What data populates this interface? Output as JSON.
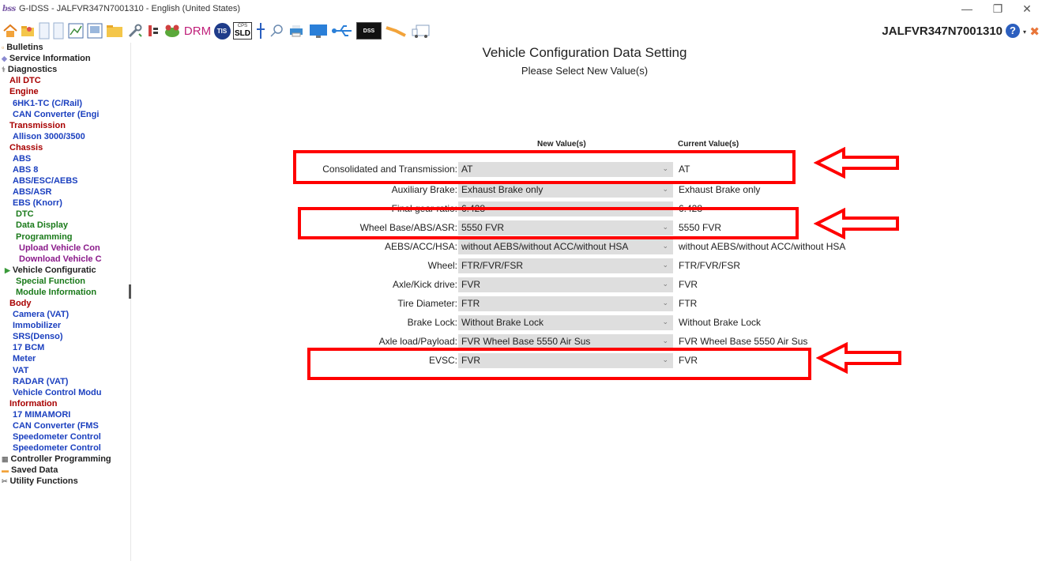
{
  "window": {
    "app_logo": "bss",
    "title": "G-IDSS - JALFVR347N7001310 - English (United States)",
    "controls": [
      "—",
      "❐",
      "✕"
    ]
  },
  "toolbar": {
    "icons": [
      "home-icon",
      "open-folder-icon",
      "blank-page-icon",
      "blank-page-2-icon",
      "graph-icon",
      "image-icon",
      "folder-icon",
      "wrench-icon",
      "connector-icon",
      "frog-icon",
      "drm-icon",
      "tis-icon",
      "cps-sld-icon",
      "pin-icon",
      "search-icon",
      "print-icon",
      "monitor-icon",
      "usb-icon",
      "dss-icon",
      "plane-icon",
      "truck-icon"
    ],
    "drm_label": "DRM",
    "tis_label": "TIS",
    "cps_label": "CPS",
    "sld_label": "SLD",
    "dss_label": "DSS",
    "vin": "JALFVR347N7001310",
    "help_label": "?"
  },
  "sidebar": {
    "items": [
      {
        "label": "Bulletins",
        "color": "#222222",
        "icon": "bulletins-icon"
      },
      {
        "label": "Service Information",
        "color": "#222222",
        "icon": "service-info-icon"
      },
      {
        "label": "Diagnostics",
        "color": "#222222",
        "icon": "diagnostics-icon"
      },
      {
        "label": "All DTC",
        "color": "#a80000"
      },
      {
        "label": "Engine",
        "color": "#a80000"
      },
      {
        "label": "6HK1-TC (C/Rail)",
        "color": "#1a3fbf"
      },
      {
        "label": "CAN Converter (Engi",
        "color": "#1a3fbf"
      },
      {
        "label": "Transmission",
        "color": "#a80000"
      },
      {
        "label": "Allison 3000/3500",
        "color": "#1a3fbf"
      },
      {
        "label": "Chassis",
        "color": "#a80000"
      },
      {
        "label": "ABS",
        "color": "#1a3fbf"
      },
      {
        "label": "ABS 8",
        "color": "#1a3fbf"
      },
      {
        "label": "ABS/ESC/AEBS",
        "color": "#1a3fbf"
      },
      {
        "label": "ABS/ASR",
        "color": "#1a3fbf"
      },
      {
        "label": "EBS (Knorr)",
        "color": "#1a3fbf"
      },
      {
        "label": "DTC",
        "color": "#1a7a1a"
      },
      {
        "label": "Data Display",
        "color": "#1a7a1a"
      },
      {
        "label": "Programming",
        "color": "#1a7a1a"
      },
      {
        "label": "Upload Vehicle Con",
        "color": "#8a1a8a"
      },
      {
        "label": "Download Vehicle C",
        "color": "#8a1a8a"
      },
      {
        "label": "Vehicle Configuratic",
        "color": "#222222",
        "icon": "triangle-right-icon"
      },
      {
        "label": "Special Function",
        "color": "#1a7a1a"
      },
      {
        "label": "Module Information",
        "color": "#1a7a1a"
      },
      {
        "label": "Body",
        "color": "#a80000"
      },
      {
        "label": "Camera (VAT)",
        "color": "#1a3fbf"
      },
      {
        "label": "Immobilizer",
        "color": "#1a3fbf"
      },
      {
        "label": "SRS(Denso)",
        "color": "#1a3fbf"
      },
      {
        "label": "17 BCM",
        "color": "#1a3fbf"
      },
      {
        "label": "Meter",
        "color": "#1a3fbf"
      },
      {
        "label": "VAT",
        "color": "#1a3fbf"
      },
      {
        "label": "RADAR (VAT)",
        "color": "#1a3fbf"
      },
      {
        "label": "Vehicle Control Modu",
        "color": "#1a3fbf"
      },
      {
        "label": "Information",
        "color": "#a80000"
      },
      {
        "label": "17 MIMAMORI",
        "color": "#1a3fbf"
      },
      {
        "label": "CAN Converter (FMS",
        "color": "#1a3fbf"
      },
      {
        "label": "Speedometer Control",
        "color": "#1a3fbf"
      },
      {
        "label": "Speedometer Control",
        "color": "#1a3fbf"
      },
      {
        "label": "Controller Programming",
        "color": "#222222",
        "icon": "controller-programming-icon"
      },
      {
        "label": "Saved Data",
        "color": "#222222",
        "icon": "saved-data-icon"
      },
      {
        "label": "Utility Functions",
        "color": "#222222",
        "icon": "utility-functions-icon"
      }
    ]
  },
  "main": {
    "title": "Vehicle Configuration Data Setting",
    "subtitle": "Please Select New Value(s)",
    "new_header": "New Value(s)",
    "current_header": "Current Value(s)",
    "rows": [
      {
        "label": "Consolidated and Transmission:",
        "new": "AT",
        "current": "AT"
      },
      {
        "label": "Auxiliary Brake:",
        "new": "Exhaust Brake only",
        "current": "Exhaust Brake only"
      },
      {
        "label": "Final gear ratio:",
        "new": "6.428",
        "current": "6.428"
      },
      {
        "label": "Wheel Base/ABS/ASR:",
        "new": "5550 FVR",
        "current": "5550 FVR"
      },
      {
        "label": "AEBS/ACC/HSA:",
        "new": "without AEBS/without ACC/without HSA",
        "current": "without AEBS/without ACC/without HSA"
      },
      {
        "label": "Wheel:",
        "new": "FTR/FVR/FSR",
        "current": "FTR/FVR/FSR"
      },
      {
        "label": "Axle/Kick drive:",
        "new": "FVR",
        "current": "FVR"
      },
      {
        "label": "Tire Diameter:",
        "new": "FTR",
        "current": "FTR"
      },
      {
        "label": "Brake Lock:",
        "new": "Without Brake Lock",
        "current": "Without Brake Lock"
      },
      {
        "label": "Axle load/Payload:",
        "new": "FVR Wheel Base 5550 Air Sus",
        "current": "FVR Wheel Base 5550 Air Sus"
      },
      {
        "label": "EVSC:",
        "new": "FVR",
        "current": "FVR"
      }
    ],
    "chevron": "⌄",
    "highlight_color": "#ff0000"
  }
}
